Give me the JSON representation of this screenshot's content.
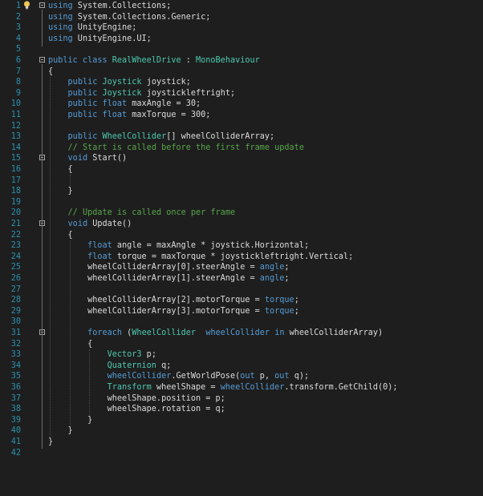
{
  "editor": {
    "lines": [
      {
        "n": "1",
        "fold": true,
        "segs": [
          {
            "t": "using",
            "c": "kw"
          },
          {
            "t": " System.Collections;",
            "c": "p"
          }
        ]
      },
      {
        "n": "2",
        "segs": [
          {
            "t": "using",
            "c": "kw"
          },
          {
            "t": " System.Collections.Generic;",
            "c": "p"
          }
        ]
      },
      {
        "n": "3",
        "segs": [
          {
            "t": "using",
            "c": "kw"
          },
          {
            "t": " UnityEngine;",
            "c": "p"
          }
        ]
      },
      {
        "n": "4",
        "segs": [
          {
            "t": "using",
            "c": "kw"
          },
          {
            "t": " UnityEngine.UI;",
            "c": "p"
          }
        ]
      },
      {
        "n": "5",
        "segs": []
      },
      {
        "n": "6",
        "fold": true,
        "segs": [
          {
            "t": "public class ",
            "c": "kw"
          },
          {
            "t": "RealWheelDrive",
            "c": "ty"
          },
          {
            "t": " : ",
            "c": "p"
          },
          {
            "t": "MonoBehaviour",
            "c": "ty"
          }
        ]
      },
      {
        "n": "7",
        "segs": [
          {
            "t": "{",
            "c": "p"
          }
        ]
      },
      {
        "n": "8",
        "segs": [
          {
            "t": "    ",
            "c": "p"
          },
          {
            "t": "public ",
            "c": "kw"
          },
          {
            "t": "Joystick",
            "c": "ty"
          },
          {
            "t": " joystick;",
            "c": "p"
          }
        ]
      },
      {
        "n": "9",
        "segs": [
          {
            "t": "    ",
            "c": "p"
          },
          {
            "t": "public ",
            "c": "kw"
          },
          {
            "t": "Joystick",
            "c": "ty"
          },
          {
            "t": " joystickleftright;",
            "c": "p"
          }
        ]
      },
      {
        "n": "10",
        "segs": [
          {
            "t": "    ",
            "c": "p"
          },
          {
            "t": "public float",
            "c": "kw"
          },
          {
            "t": " maxAngle = 30;",
            "c": "p"
          }
        ]
      },
      {
        "n": "11",
        "segs": [
          {
            "t": "    ",
            "c": "p"
          },
          {
            "t": "public float",
            "c": "kw"
          },
          {
            "t": " maxTorque = 300;",
            "c": "p"
          }
        ]
      },
      {
        "n": "12",
        "segs": []
      },
      {
        "n": "13",
        "segs": [
          {
            "t": "    ",
            "c": "p"
          },
          {
            "t": "public ",
            "c": "kw"
          },
          {
            "t": "WheelCollider",
            "c": "ty"
          },
          {
            "t": "[] wheelColliderArray;",
            "c": "p"
          }
        ]
      },
      {
        "n": "14",
        "segs": [
          {
            "t": "    ",
            "c": "p"
          },
          {
            "t": "// Start is called before the first frame update",
            "c": "cm"
          }
        ]
      },
      {
        "n": "15",
        "fold": true,
        "segs": [
          {
            "t": "    ",
            "c": "p"
          },
          {
            "t": "void",
            "c": "kw"
          },
          {
            "t": " Start()",
            "c": "p"
          }
        ]
      },
      {
        "n": "16",
        "segs": [
          {
            "t": "    {",
            "c": "p"
          }
        ]
      },
      {
        "n": "17",
        "segs": []
      },
      {
        "n": "18",
        "segs": [
          {
            "t": "    }",
            "c": "p"
          }
        ]
      },
      {
        "n": "19",
        "segs": []
      },
      {
        "n": "20",
        "segs": [
          {
            "t": "    ",
            "c": "p"
          },
          {
            "t": "// Update is called once per frame",
            "c": "cm"
          }
        ]
      },
      {
        "n": "21",
        "fold": true,
        "segs": [
          {
            "t": "    ",
            "c": "p"
          },
          {
            "t": "void",
            "c": "kw"
          },
          {
            "t": " Update()",
            "c": "p"
          }
        ]
      },
      {
        "n": "22",
        "segs": [
          {
            "t": "    {",
            "c": "p"
          }
        ]
      },
      {
        "n": "23",
        "segs": [
          {
            "t": "        ",
            "c": "p"
          },
          {
            "t": "float",
            "c": "kw"
          },
          {
            "t": " angle = maxAngle * joystick.Horizontal;",
            "c": "p"
          }
        ]
      },
      {
        "n": "24",
        "segs": [
          {
            "t": "        ",
            "c": "p"
          },
          {
            "t": "float",
            "c": "kw"
          },
          {
            "t": " torque = maxTorque * joystickleftright.Vertical;",
            "c": "p"
          }
        ]
      },
      {
        "n": "25",
        "segs": [
          {
            "t": "        wheelColliderArray[0].steerAngle = ",
            "c": "p"
          },
          {
            "t": "angle",
            "c": "kw"
          },
          {
            "t": ";",
            "c": "p"
          }
        ]
      },
      {
        "n": "26",
        "segs": [
          {
            "t": "        wheelColliderArray[1].steerAngle = ",
            "c": "p"
          },
          {
            "t": "angle",
            "c": "kw"
          },
          {
            "t": ";",
            "c": "p"
          }
        ]
      },
      {
        "n": "27",
        "segs": []
      },
      {
        "n": "28",
        "segs": [
          {
            "t": "        wheelColliderArray[2].motorTorque = ",
            "c": "p"
          },
          {
            "t": "torque",
            "c": "kw"
          },
          {
            "t": ";",
            "c": "p"
          }
        ]
      },
      {
        "n": "29",
        "segs": [
          {
            "t": "        wheelColliderArray[3].motorTorque = ",
            "c": "p"
          },
          {
            "t": "torque",
            "c": "kw"
          },
          {
            "t": ";",
            "c": "p"
          }
        ]
      },
      {
        "n": "30",
        "segs": []
      },
      {
        "n": "31",
        "fold": true,
        "segs": [
          {
            "t": "        ",
            "c": "p"
          },
          {
            "t": "foreach",
            "c": "kw"
          },
          {
            "t": " (",
            "c": "p"
          },
          {
            "t": "WheelCollider",
            "c": "ty"
          },
          {
            "t": "  ",
            "c": "p"
          },
          {
            "t": "wheelCollider",
            "c": "kw"
          },
          {
            "t": " ",
            "c": "p"
          },
          {
            "t": "in",
            "c": "kw"
          },
          {
            "t": " wheelColliderArray)",
            "c": "p"
          }
        ]
      },
      {
        "n": "32",
        "segs": [
          {
            "t": "        {",
            "c": "p"
          }
        ]
      },
      {
        "n": "33",
        "segs": [
          {
            "t": "            ",
            "c": "p"
          },
          {
            "t": "Vector3",
            "c": "ty"
          },
          {
            "t": " p;",
            "c": "p"
          }
        ]
      },
      {
        "n": "34",
        "segs": [
          {
            "t": "            ",
            "c": "p"
          },
          {
            "t": "Quaternion",
            "c": "ty"
          },
          {
            "t": " q;",
            "c": "p"
          }
        ]
      },
      {
        "n": "35",
        "segs": [
          {
            "t": "            ",
            "c": "p"
          },
          {
            "t": "wheelCollider",
            "c": "kw"
          },
          {
            "t": ".GetWorldPose(",
            "c": "p"
          },
          {
            "t": "out",
            "c": "kw"
          },
          {
            "t": " p, ",
            "c": "p"
          },
          {
            "t": "out",
            "c": "kw"
          },
          {
            "t": " q);",
            "c": "p"
          }
        ]
      },
      {
        "n": "36",
        "segs": [
          {
            "t": "            ",
            "c": "p"
          },
          {
            "t": "Transform",
            "c": "ty"
          },
          {
            "t": " wheelShape = ",
            "c": "p"
          },
          {
            "t": "wheelCollider",
            "c": "kw"
          },
          {
            "t": ".transform.GetChild(0);",
            "c": "p"
          }
        ]
      },
      {
        "n": "37",
        "segs": [
          {
            "t": "            wheelShape.position = p;",
            "c": "p"
          }
        ]
      },
      {
        "n": "38",
        "segs": [
          {
            "t": "            wheelShape.rotation = q;",
            "c": "p"
          }
        ]
      },
      {
        "n": "39",
        "segs": [
          {
            "t": "        }",
            "c": "p"
          }
        ]
      },
      {
        "n": "40",
        "segs": [
          {
            "t": "    }",
            "c": "p"
          }
        ]
      },
      {
        "n": "41",
        "segs": [
          {
            "t": "}",
            "c": "p"
          }
        ]
      },
      {
        "n": "42",
        "segs": []
      }
    ],
    "colors": {
      "keyword": "#569cd6",
      "type": "#4ec9b0",
      "comment": "#57a64a",
      "plain": "#dcdcdc",
      "line_number": "#2b91af",
      "background": "#1e1e1e"
    },
    "icons": {
      "gutter": "lightbulb-icon",
      "fold": "collapse-box-icon"
    }
  }
}
